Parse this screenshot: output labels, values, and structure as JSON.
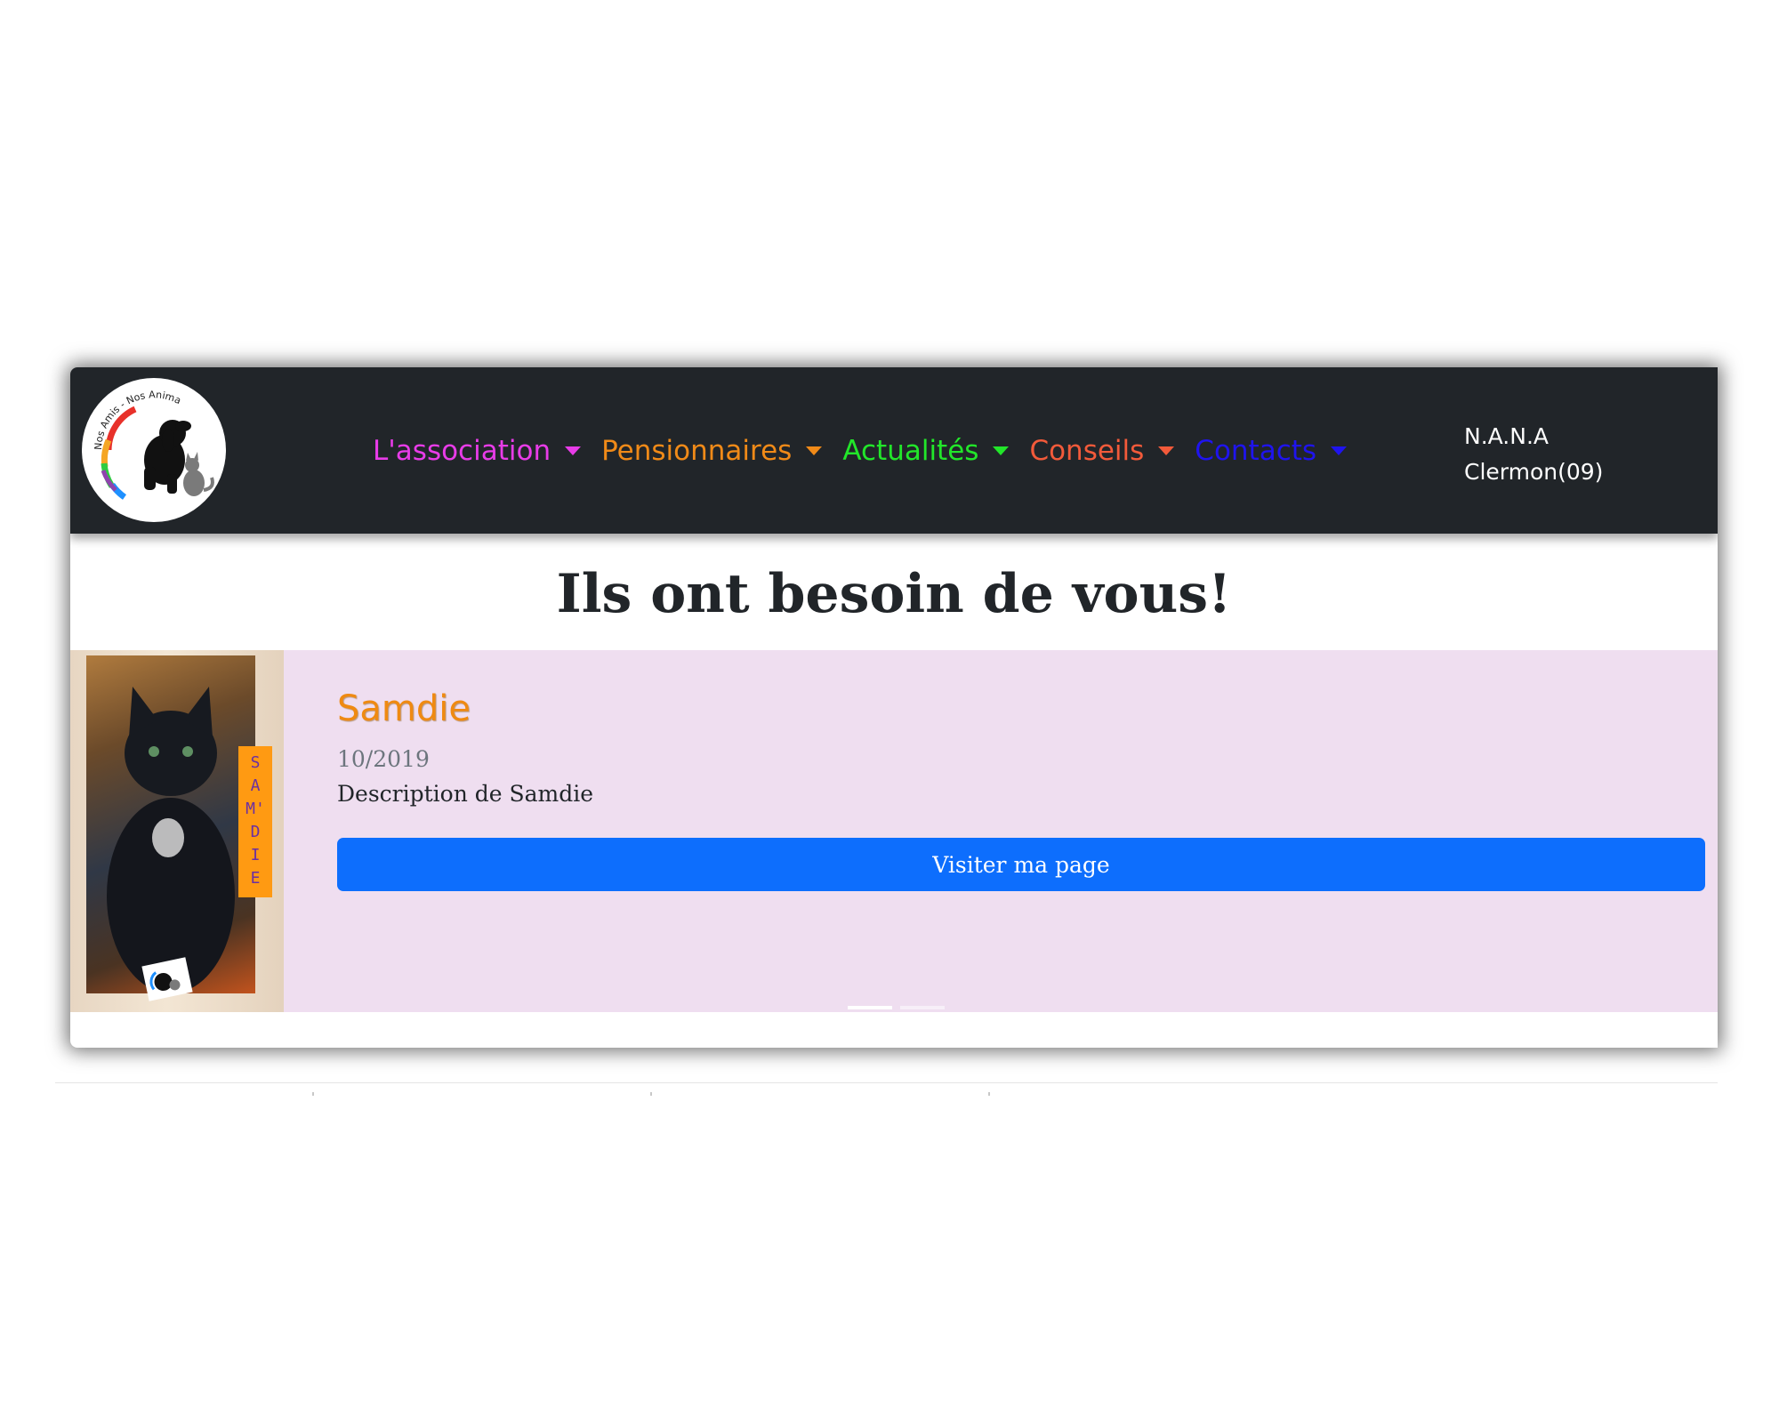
{
  "navbar": {
    "logo_alt": "Nos Amis - Nos Animaux",
    "items": [
      {
        "label": "L'association",
        "color": "#e83ce8"
      },
      {
        "label": "Pensionnaires",
        "color": "#f08a18"
      },
      {
        "label": "Actualités",
        "color": "#22e62a"
      },
      {
        "label": "Conseils",
        "color": "#f25a3a"
      },
      {
        "label": "Contacts",
        "color": "#1f14ee"
      }
    ],
    "brand_line1": "N.A.N.A",
    "brand_line2": "Clermon(09)"
  },
  "main": {
    "title": "Ils ont besoin de vous!"
  },
  "carousel": {
    "slide": {
      "name": "Samdie",
      "date": "10/2019",
      "description": "Description de Samdie",
      "button_label": "Visiter ma page",
      "photo_tag": "SAM'DIE"
    },
    "indicators": [
      {
        "active": true
      },
      {
        "active": false
      }
    ]
  },
  "colors": {
    "navbar_bg": "#212529",
    "carousel_bg": "#efdef0",
    "button_bg": "#0d6efd",
    "name_color": "#ef8a12"
  }
}
